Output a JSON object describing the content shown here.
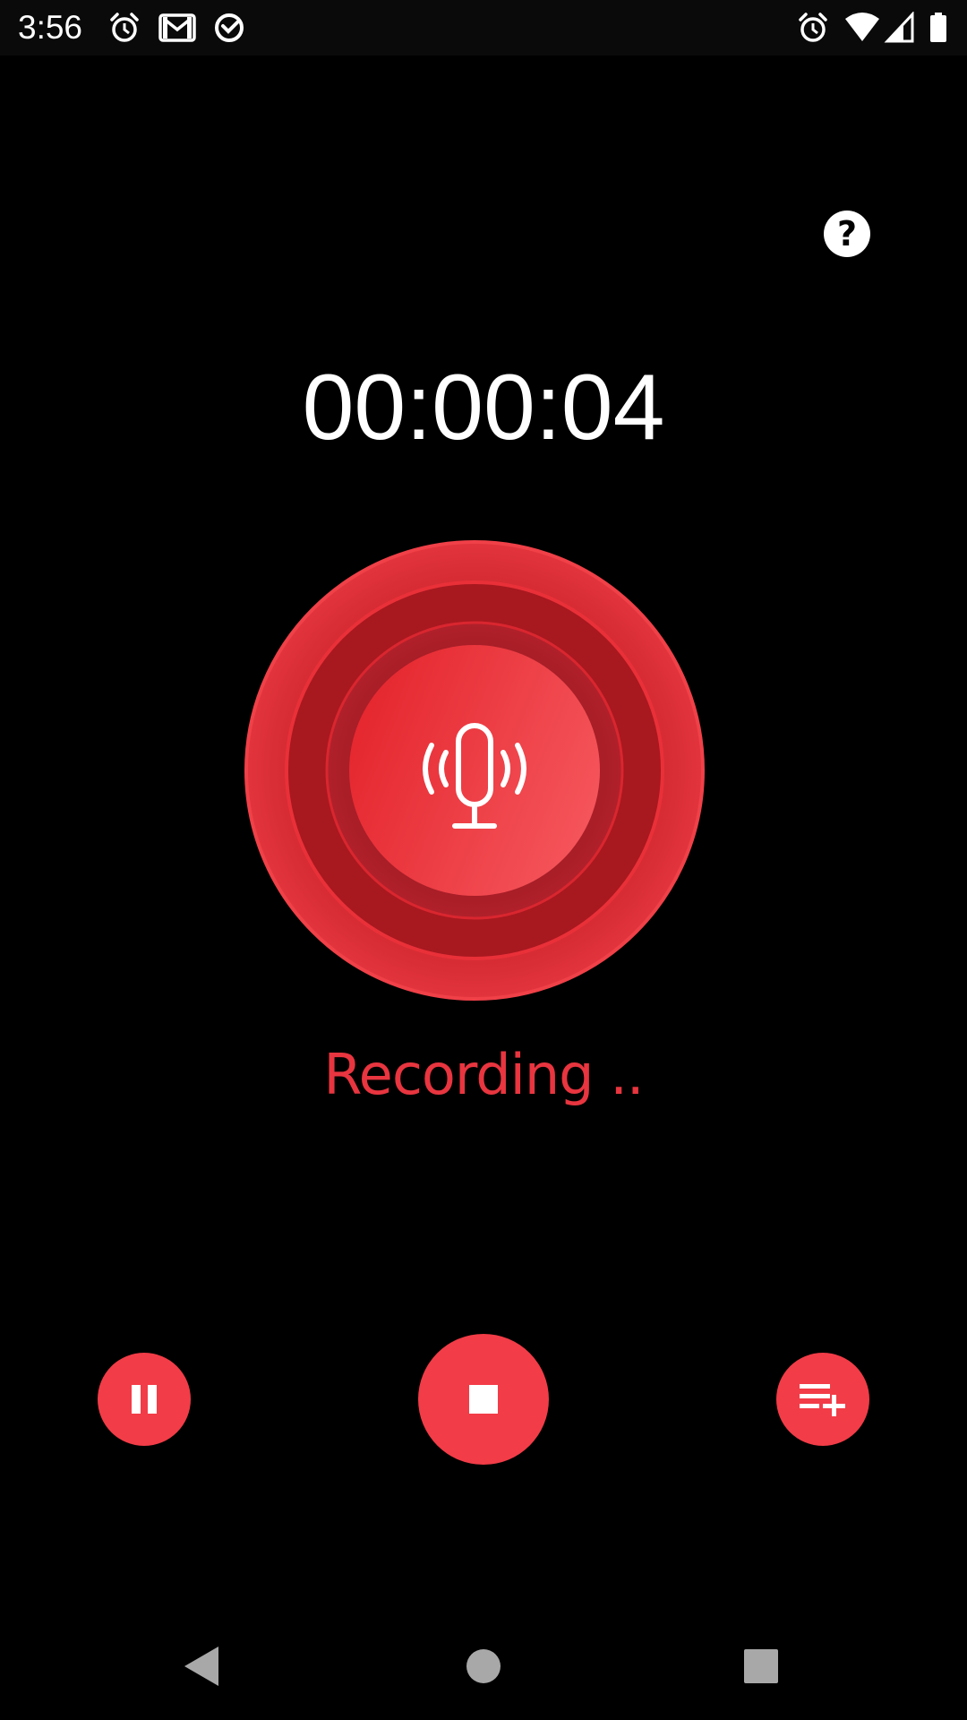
{
  "status_bar": {
    "time": "3:56",
    "left_icons": [
      "alarm-icon",
      "gmail-icon",
      "sync-icon"
    ],
    "right_icons": [
      "alarm-icon",
      "wifi-icon",
      "cell-signal-icon",
      "battery-icon"
    ]
  },
  "help": {
    "glyph": "?"
  },
  "timer": {
    "elapsed": "00:00:04"
  },
  "recorder": {
    "status_text": "Recording ..",
    "icon": "microphone-icon"
  },
  "controls": {
    "pause_icon": "pause-icon",
    "stop_icon": "stop-icon",
    "add_icon": "playlist-add-icon"
  },
  "nav": {
    "items": [
      "back-icon",
      "home-icon",
      "recents-icon"
    ]
  },
  "colors": {
    "accent": "#f23c47",
    "accent_dark": "#8a1418",
    "status_text": "#e8353f",
    "background": "#000000"
  }
}
